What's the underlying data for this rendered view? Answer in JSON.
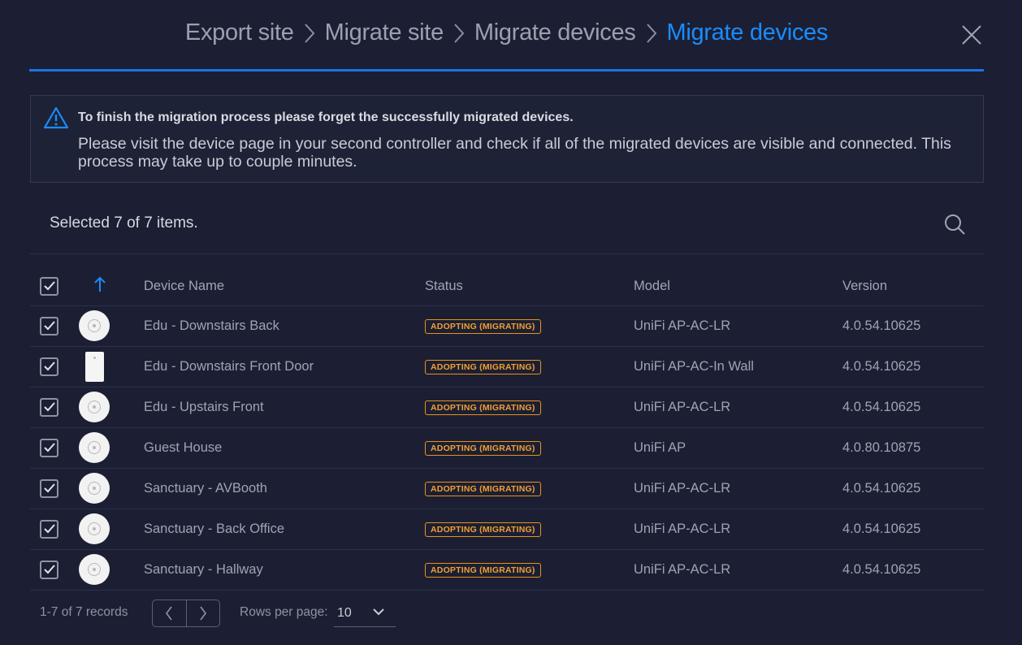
{
  "wizard": {
    "steps": [
      {
        "label": "Export site",
        "active": false
      },
      {
        "label": "Migrate site",
        "active": false
      },
      {
        "label": "Migrate devices",
        "active": false
      },
      {
        "label": "Migrate devices",
        "active": true
      }
    ],
    "accent_color": "#1a73e8"
  },
  "notice": {
    "icon": "warning-triangle-icon",
    "title": "To finish the migration process please forget the successfully migrated devices.",
    "body": "Please visit the device page in your second controller and check if all of the migrated devices are visible and connected. This process may take up to couple minutes."
  },
  "toolbar": {
    "selected_text": "Selected 7 of 7 items.",
    "search_icon": "search-icon"
  },
  "table": {
    "columns": [
      "Device Name",
      "Status",
      "Model",
      "Version"
    ],
    "sort_icon": "arrow-up-icon",
    "all_checked": true,
    "rows": [
      {
        "checked": true,
        "image": "ap-round",
        "name": "Edu - Downstairs Back",
        "status": "ADOPTING (MIGRATING)",
        "model": "UniFi AP-AC-LR",
        "version": "4.0.54.10625"
      },
      {
        "checked": true,
        "image": "ap-wall",
        "name": "Edu - Downstairs Front Door",
        "status": "ADOPTING (MIGRATING)",
        "model": "UniFi AP-AC-In Wall",
        "version": "4.0.54.10625"
      },
      {
        "checked": true,
        "image": "ap-round",
        "name": "Edu - Upstairs Front",
        "status": "ADOPTING (MIGRATING)",
        "model": "UniFi AP-AC-LR",
        "version": "4.0.54.10625"
      },
      {
        "checked": true,
        "image": "ap-round",
        "name": "Guest House",
        "status": "ADOPTING (MIGRATING)",
        "model": "UniFi AP",
        "version": "4.0.80.10875"
      },
      {
        "checked": true,
        "image": "ap-round",
        "name": "Sanctuary - AVBooth",
        "status": "ADOPTING (MIGRATING)",
        "model": "UniFi AP-AC-LR",
        "version": "4.0.54.10625"
      },
      {
        "checked": true,
        "image": "ap-round",
        "name": "Sanctuary - Back Office",
        "status": "ADOPTING (MIGRATING)",
        "model": "UniFi AP-AC-LR",
        "version": "4.0.54.10625"
      },
      {
        "checked": true,
        "image": "ap-round",
        "name": "Sanctuary - Hallway",
        "status": "ADOPTING (MIGRATING)",
        "model": "UniFi AP-AC-LR",
        "version": "4.0.54.10625"
      }
    ]
  },
  "footer": {
    "records": "1-7 of 7 records",
    "rows_per_page_label": "Rows per page:",
    "rows_per_page_value": "10"
  }
}
